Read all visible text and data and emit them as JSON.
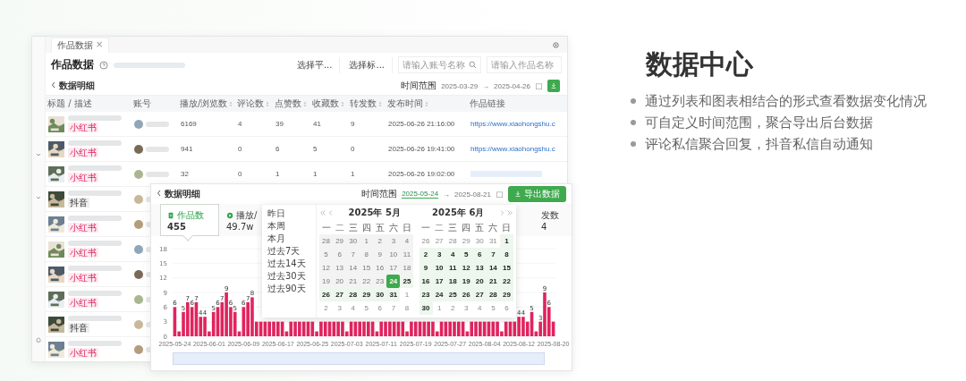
{
  "left_window": {
    "tab": {
      "label": "作品数据",
      "close": "×"
    },
    "title": "作品数据",
    "filters": [
      {
        "kind": "select",
        "text": "选择平..."
      },
      {
        "kind": "select",
        "text": "选择标..."
      },
      {
        "kind": "search",
        "placeholder": "请输入账号名称"
      },
      {
        "kind": "input",
        "placeholder": "请输入作品名称"
      }
    ],
    "back_label": "数据明细",
    "time_range": {
      "label": "时间范围",
      "start": "2025-03-29",
      "arrow": "→",
      "end": "2025-04-26"
    },
    "table": {
      "columns": [
        {
          "label": "标题 / 描述",
          "sortable": false
        },
        {
          "label": "账号",
          "sortable": false
        },
        {
          "label": "播放/浏览数",
          "sortable": true
        },
        {
          "label": "评论数",
          "sortable": true
        },
        {
          "label": "点赞数",
          "sortable": true
        },
        {
          "label": "收藏数",
          "sortable": true
        },
        {
          "label": "转发数",
          "sortable": true
        },
        {
          "label": "发布时间",
          "sortable": true
        },
        {
          "label": "作品链接",
          "sortable": false
        }
      ],
      "rows": [
        {
          "tag": "小红书",
          "kind": "xiaohongshu",
          "cells": [
            "6169",
            "4",
            "39",
            "41",
            "9",
            "2025-06-26 21:16:00"
          ],
          "link": "https://www.xiaohongshu.c"
        },
        {
          "tag": "小红书",
          "kind": "xiaohongshu",
          "cells": [
            "941",
            "0",
            "6",
            "5",
            "0",
            "2025-06-26 19:41:00"
          ],
          "link": "https://www.xiaohongshu.c"
        },
        {
          "tag": "小红书",
          "kind": "xiaohongshu",
          "cells": [
            "32",
            "0",
            "1",
            "1",
            "1",
            "2025-06-26 19:02:00"
          ],
          "link_redacted": true
        },
        {
          "tag": "抖音",
          "kind": "douyin"
        },
        {
          "tag": "小红书",
          "kind": "xiaohongshu"
        },
        {
          "tag": "小红书",
          "kind": "xiaohongshu"
        },
        {
          "tag": "小红书",
          "kind": "xiaohongshu"
        },
        {
          "tag": "小红书",
          "kind": "xiaohongshu"
        },
        {
          "tag": "抖音",
          "kind": "douyin"
        },
        {
          "tag": "小红书",
          "kind": "xiaohongshu"
        }
      ]
    }
  },
  "front_window": {
    "back_label": "数据明细",
    "time_range": {
      "label": "时间范围",
      "start": "2025-05-24",
      "arrow": "→",
      "end": "2025-08-21"
    },
    "export_button": "导出数据",
    "metrics": [
      {
        "label": "作品数",
        "value": "455",
        "selected": true
      },
      {
        "label": "播放/",
        "value": "49.7w",
        "selected": false
      },
      {
        "label": "发数",
        "value": "4",
        "selected": false
      }
    ],
    "chart_data": {
      "type": "bar",
      "ylim": [
        0,
        18
      ],
      "yticks": [
        0,
        3,
        6,
        9,
        12,
        15,
        18
      ],
      "grid": true,
      "categories": [
        "2025-05-24",
        null,
        null,
        null,
        null,
        null,
        null,
        null,
        "2025-06-01",
        null,
        null,
        null,
        null,
        null,
        null,
        null,
        "2025-06-09",
        null,
        null,
        null,
        null,
        null,
        null,
        null,
        "2025-06-17",
        null,
        null,
        null,
        null,
        null,
        null,
        null,
        "2025-06-25",
        null,
        null,
        null,
        null,
        null,
        null,
        null,
        "2025-07-03",
        null,
        null,
        null,
        null,
        null,
        null,
        null,
        "2025-07-11",
        null,
        null,
        null,
        null,
        null,
        null,
        null,
        "2025-07-19",
        null,
        null,
        null,
        null,
        null,
        null,
        null,
        "2025-07-27",
        null,
        null,
        null,
        null,
        null,
        null,
        null,
        "2025-08-04",
        null,
        null,
        null,
        null,
        null,
        null,
        null,
        "2025-08-12",
        null,
        null,
        null,
        null,
        null,
        null,
        null,
        "2025-08-20"
      ],
      "value_labels": [
        "6",
        null,
        "5",
        "7",
        "6",
        "7",
        "4",
        "4",
        null,
        "5",
        "6",
        "7",
        "9",
        "6",
        "5",
        null,
        "6",
        "7",
        "8",
        null,
        null,
        null,
        null,
        null,
        null,
        null,
        null,
        null,
        null,
        null,
        null,
        null,
        null,
        null,
        null,
        null,
        null,
        null,
        null,
        null,
        null,
        null,
        null,
        null,
        null,
        null,
        null,
        null,
        null,
        null,
        null,
        null,
        null,
        null,
        null,
        null,
        null,
        null,
        null,
        null,
        null,
        null,
        null,
        null,
        null,
        null,
        null,
        null,
        null,
        null,
        null,
        null,
        null,
        null,
        null,
        null,
        null,
        null,
        null,
        null,
        "4",
        "4",
        null,
        "5",
        null,
        "3",
        "9",
        "6",
        null
      ],
      "series": [
        {
          "color": "#e0245e",
          "values": [
            6,
            1,
            5,
            7,
            6,
            7,
            4,
            4,
            1,
            5,
            6,
            7,
            9,
            6,
            5,
            1,
            6,
            7,
            8,
            3,
            3,
            3,
            3,
            3,
            3,
            3,
            1,
            3,
            3,
            3,
            3,
            3,
            3,
            1,
            3,
            3,
            3,
            3,
            3,
            3,
            1,
            3,
            3,
            3,
            3,
            3,
            3,
            1,
            3,
            3,
            3,
            3,
            3,
            3,
            1,
            3,
            3,
            3,
            3,
            3,
            3,
            1,
            3,
            3,
            3,
            3,
            3,
            3,
            1,
            3,
            3,
            3,
            3,
            3,
            3,
            3,
            1,
            3,
            3,
            3,
            4,
            4,
            3,
            5,
            1,
            3,
            9,
            6,
            3
          ]
        }
      ]
    },
    "date_picker": {
      "shortcuts": [
        "昨日",
        "本周",
        "本月",
        "过去7天",
        "过去14天",
        "过去30天",
        "过去90天"
      ],
      "months": [
        {
          "title": "2025年 5月",
          "kind": "prev",
          "weekdays": [
            "一",
            "二",
            "三",
            "四",
            "五",
            "六",
            "日"
          ],
          "weeks": [
            [
              {
                "d": "28",
                "kind": "disabled"
              },
              {
                "d": "29",
                "kind": "disabled"
              },
              {
                "d": "30",
                "kind": "disabled"
              },
              {
                "d": "1",
                "kind": "disabled"
              },
              {
                "d": "2",
                "kind": "disabled"
              },
              {
                "d": "3",
                "kind": "disabled"
              },
              {
                "d": "4",
                "kind": "disabled"
              }
            ],
            [
              {
                "d": "5",
                "kind": "disabled"
              },
              {
                "d": "6",
                "kind": "disabled"
              },
              {
                "d": "7",
                "kind": "disabled"
              },
              {
                "d": "8",
                "kind": "disabled"
              },
              {
                "d": "9",
                "kind": "disabled"
              },
              {
                "d": "10",
                "kind": "disabled"
              },
              {
                "d": "11",
                "kind": "disabled"
              }
            ],
            [
              {
                "d": "12",
                "kind": "disabled"
              },
              {
                "d": "13",
                "kind": "disabled"
              },
              {
                "d": "14",
                "kind": "disabled"
              },
              {
                "d": "15",
                "kind": "disabled"
              },
              {
                "d": "16",
                "kind": "disabled"
              },
              {
                "d": "17",
                "kind": "disabled"
              },
              {
                "d": "18",
                "kind": "disabled"
              }
            ],
            [
              {
                "d": "19",
                "kind": "disabled"
              },
              {
                "d": "20",
                "kind": "disabled"
              },
              {
                "d": "21",
                "kind": "disabled"
              },
              {
                "d": "22",
                "kind": "disabled"
              },
              {
                "d": "23",
                "kind": "disabled"
              },
              {
                "d": "24",
                "kind": "start"
              },
              {
                "d": "25",
                "kind": "range"
              }
            ],
            [
              {
                "d": "26",
                "kind": "range"
              },
              {
                "d": "27",
                "kind": "range"
              },
              {
                "d": "28",
                "kind": "range"
              },
              {
                "d": "29",
                "kind": "range"
              },
              {
                "d": "30",
                "kind": "range"
              },
              {
                "d": "31",
                "kind": "range"
              },
              {
                "d": "1",
                "kind": "other"
              }
            ],
            [
              {
                "d": "2",
                "kind": "other"
              },
              {
                "d": "3",
                "kind": "other"
              },
              {
                "d": "4",
                "kind": "other"
              },
              {
                "d": "5",
                "kind": "other"
              },
              {
                "d": "6",
                "kind": "other"
              },
              {
                "d": "7",
                "kind": "other"
              },
              {
                "d": "8",
                "kind": "other"
              }
            ]
          ]
        },
        {
          "title": "2025年 6月",
          "kind": "next",
          "weekdays": [
            "一",
            "二",
            "三",
            "四",
            "五",
            "六",
            "日"
          ],
          "weeks": [
            [
              {
                "d": "26",
                "kind": "other"
              },
              {
                "d": "27",
                "kind": "other"
              },
              {
                "d": "28",
                "kind": "other"
              },
              {
                "d": "29",
                "kind": "other"
              },
              {
                "d": "30",
                "kind": "other"
              },
              {
                "d": "31",
                "kind": "other"
              },
              {
                "d": "1",
                "kind": "range"
              }
            ],
            [
              {
                "d": "2",
                "kind": "range"
              },
              {
                "d": "3",
                "kind": "range"
              },
              {
                "d": "4",
                "kind": "range"
              },
              {
                "d": "5",
                "kind": "range"
              },
              {
                "d": "6",
                "kind": "range"
              },
              {
                "d": "7",
                "kind": "range"
              },
              {
                "d": "8",
                "kind": "range"
              }
            ],
            [
              {
                "d": "9",
                "kind": "range"
              },
              {
                "d": "10",
                "kind": "range"
              },
              {
                "d": "11",
                "kind": "range"
              },
              {
                "d": "12",
                "kind": "range"
              },
              {
                "d": "13",
                "kind": "range"
              },
              {
                "d": "14",
                "kind": "range"
              },
              {
                "d": "15",
                "kind": "range"
              }
            ],
            [
              {
                "d": "16",
                "kind": "range"
              },
              {
                "d": "17",
                "kind": "range"
              },
              {
                "d": "18",
                "kind": "range"
              },
              {
                "d": "19",
                "kind": "range"
              },
              {
                "d": "20",
                "kind": "range"
              },
              {
                "d": "21",
                "kind": "range"
              },
              {
                "d": "22",
                "kind": "range"
              }
            ],
            [
              {
                "d": "23",
                "kind": "range"
              },
              {
                "d": "24",
                "kind": "range"
              },
              {
                "d": "25",
                "kind": "range"
              },
              {
                "d": "26",
                "kind": "range"
              },
              {
                "d": "27",
                "kind": "range"
              },
              {
                "d": "28",
                "kind": "range"
              },
              {
                "d": "29",
                "kind": "range"
              }
            ],
            [
              {
                "d": "30",
                "kind": "range"
              },
              {
                "d": "1",
                "kind": "other"
              },
              {
                "d": "2",
                "kind": "other"
              },
              {
                "d": "3",
                "kind": "other"
              },
              {
                "d": "4",
                "kind": "other"
              },
              {
                "d": "5",
                "kind": "other"
              },
              {
                "d": "6",
                "kind": "other"
              }
            ]
          ]
        }
      ]
    }
  },
  "feature_panel": {
    "title": "数据中心",
    "bullets": [
      "通过列表和图表相结合的形式查看数据变化情况",
      "可自定义时间范围，聚合导出后台数据",
      "评论私信聚合回复，抖音私信自动通知"
    ]
  }
}
